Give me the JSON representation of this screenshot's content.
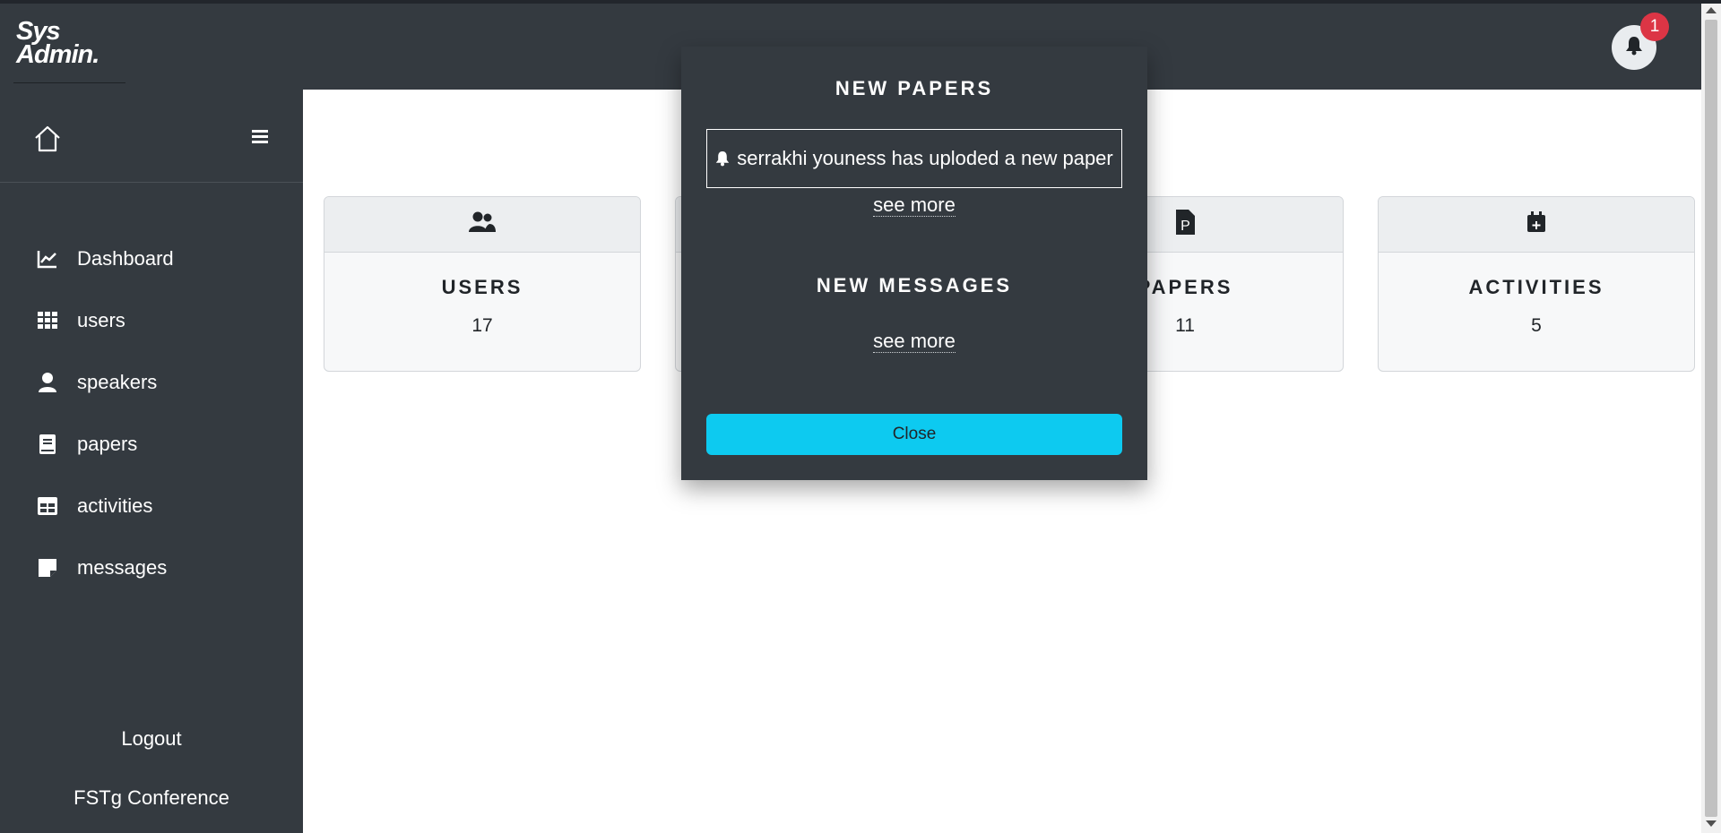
{
  "app": {
    "logo_line1": "Sys",
    "logo_line2": "Admin."
  },
  "sidebar": {
    "items": [
      {
        "label": "Dashboard",
        "icon": "chart-line-icon"
      },
      {
        "label": "users",
        "icon": "grid-icon"
      },
      {
        "label": "speakers",
        "icon": "user-icon"
      },
      {
        "label": "papers",
        "icon": "book-icon"
      },
      {
        "label": "activities",
        "icon": "table-icon"
      },
      {
        "label": "messages",
        "icon": "sticky-note-icon"
      }
    ],
    "logout_label": "Logout",
    "brand": "FSTg Conference"
  },
  "header": {
    "notification_count": "1"
  },
  "cards": [
    {
      "title": "USERS",
      "value": "17",
      "icon": "users-icon"
    },
    {
      "title": "PAPERS",
      "value": "11",
      "icon": "file-p-icon"
    },
    {
      "title": "ACTIVITIES",
      "value": "5",
      "icon": "calendar-plus-icon"
    }
  ],
  "popup": {
    "papers_heading": "NEW PAPERS",
    "paper_notification": "serrakhi youness has uploded a new paper",
    "see_more_papers": "see more",
    "messages_heading": "NEW MESSAGES",
    "see_more_messages": "see more",
    "close_label": "Close"
  },
  "colors": {
    "sidebar_bg": "#343a40",
    "accent": "#0dcaf0",
    "badge": "#dc3545"
  }
}
